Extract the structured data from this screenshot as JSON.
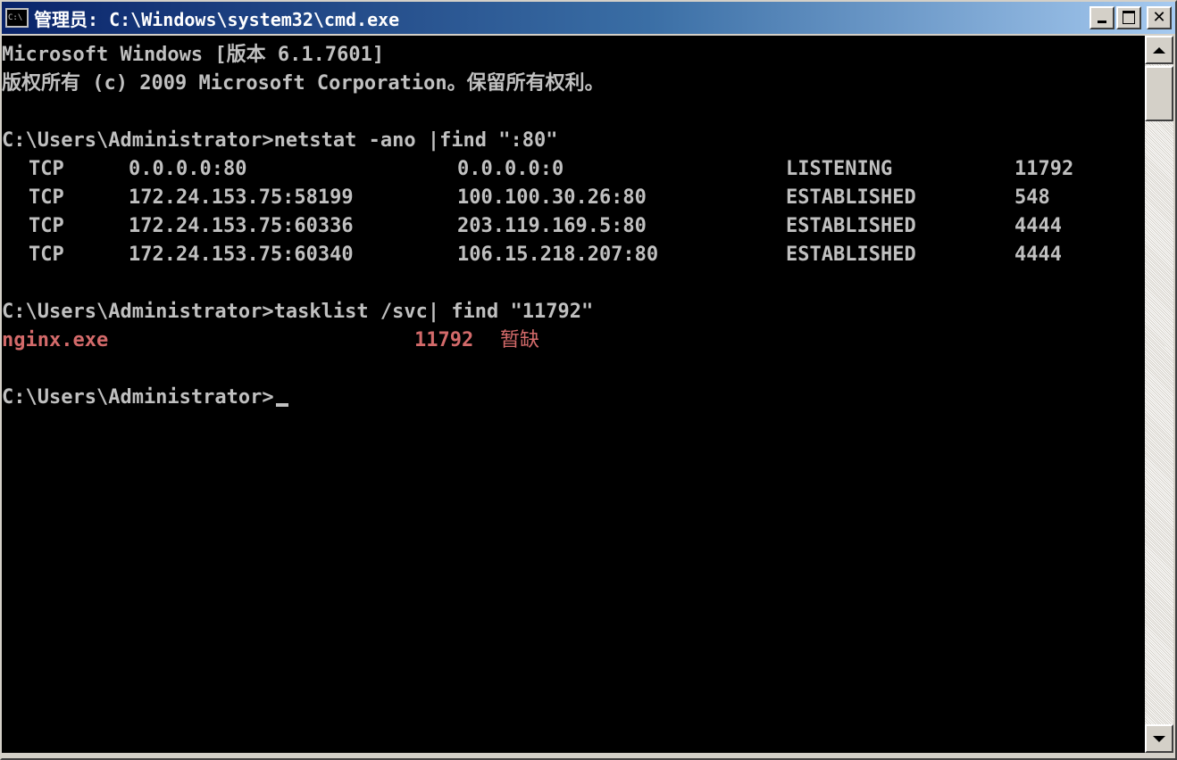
{
  "window": {
    "title": "管理员: C:\\Windows\\system32\\cmd.exe",
    "icon_label": "C:\\"
  },
  "console": {
    "banner": {
      "line1": "Microsoft Windows [版本 6.1.7601]",
      "line2": "版权所有 (c) 2009 Microsoft Corporation。保留所有权利。"
    },
    "command1": "C:\\Users\\Administrator>netstat -ano |find \":80\"",
    "netstat_rows": [
      {
        "proto": "TCP",
        "local": "0.0.0.0:80",
        "foreign": "0.0.0.0:0",
        "state": "LISTENING",
        "pid": "11792"
      },
      {
        "proto": "TCP",
        "local": "172.24.153.75:58199",
        "foreign": "100.100.30.26:80",
        "state": "ESTABLISHED",
        "pid": "548"
      },
      {
        "proto": "TCP",
        "local": "172.24.153.75:60336",
        "foreign": "203.119.169.5:80",
        "state": "ESTABLISHED",
        "pid": "4444"
      },
      {
        "proto": "TCP",
        "local": "172.24.153.75:60340",
        "foreign": "106.15.218.207:80",
        "state": "ESTABLISHED",
        "pid": "4444"
      }
    ],
    "command2": "C:\\Users\\Administrator>tasklist /svc| find \"11792\"",
    "tasklist_result": {
      "image": "nginx.exe",
      "pid": "11792",
      "services": "暂缺"
    },
    "prompt": "C:\\Users\\Administrator>"
  },
  "colors": {
    "console_bg": "#000000",
    "console_text": "#c0c0c0",
    "highlight_text": "#d36a6a",
    "title_gradient_start": "#0a246a",
    "title_gradient_end": "#a6caf0"
  }
}
